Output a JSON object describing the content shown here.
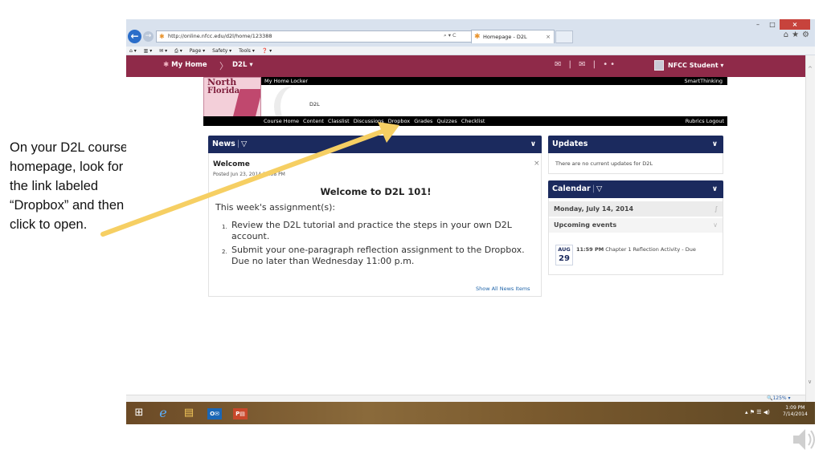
{
  "caption": "On your D2L course homepage, look for the link labeled “Dropbox” and then click to open.",
  "browser": {
    "address": "http://online.nfcc.edu/d2l/home/123388",
    "address_controls": "⌕ ▾ C",
    "tab_title": "Homepage - D2L",
    "tab_close": "×",
    "window_minimize": "–",
    "window_maximize": "□",
    "window_close": "×",
    "toolbar_icons": "⌂★⚙",
    "command_bar": [
      "⌂ ▾",
      "▥ ▾",
      "✉ ▾",
      "⎙ ▾",
      "Page ▾",
      "Safety ▾",
      "Tools ▾",
      "❓ ▾"
    ],
    "zoom": "🔍125%  ▾"
  },
  "d2l_nav": {
    "my_home": "My Home",
    "separator": "〉",
    "course": "D2L  ▾",
    "icons": "✉ | ✉ | ••",
    "user": "NFCC Student ▾"
  },
  "banner": {
    "locker_link": "My Home Locker",
    "smartthinking": "SmartThinking",
    "logo_north": "North",
    "logo_florida": "Florida",
    "title": "D2L",
    "links": [
      "Course Home",
      "Content",
      "Classlist",
      "Discussions",
      "Dropbox",
      "Grades",
      "Quizzes",
      "Checklist"
    ],
    "right_links": [
      "Rubrics",
      "Logout"
    ]
  },
  "news": {
    "header": "News",
    "menu_glyph": "▽",
    "collapse_glyph": "∨",
    "item_title": "Welcome",
    "dismiss": "×",
    "posted": "Posted Jun 23, 2014 12:58 PM",
    "headline": "Welcome to D2L 101!",
    "assignments_label": "This week's assignment(s):",
    "items": [
      {
        "num": "1.",
        "text": "Review the D2L tutorial and practice the steps in your own D2L account."
      },
      {
        "num": "2.",
        "text": "Submit your one-paragraph reflection assignment to the Dropbox. Due no later than Wednesday 11:00 p.m."
      }
    ],
    "show_all": "Show All News Items"
  },
  "updates": {
    "header": "Updates",
    "collapse_glyph": "∨",
    "text": "There are no current updates for D2L"
  },
  "calendar": {
    "header": "Calendar",
    "menu_glyph": "▽",
    "collapse_glyph": "∨",
    "date": "Monday, July 14, 2014",
    "date_glyph": "∫",
    "upcoming": "Upcoming events",
    "upcoming_glyph": "∨",
    "event": {
      "month": "AUG",
      "day": "29",
      "time": "11:59 PM",
      "title": "Chapter 1 Reflection Activity - Due"
    }
  },
  "taskbar": {
    "start": "⊞",
    "ie": "e",
    "folder": "▤",
    "outlook": "O✉",
    "powerpoint": "P▤",
    "tray": "▴  ⚑  ☰  ◀)",
    "time": "1:09 PM",
    "date": "7/14/2014"
  },
  "colors": {
    "d2l_bar": "#8f2a49",
    "widget_header": "#1b2a5e",
    "pointer_arrow": "#f6cf63",
    "link": "#2266aa"
  }
}
